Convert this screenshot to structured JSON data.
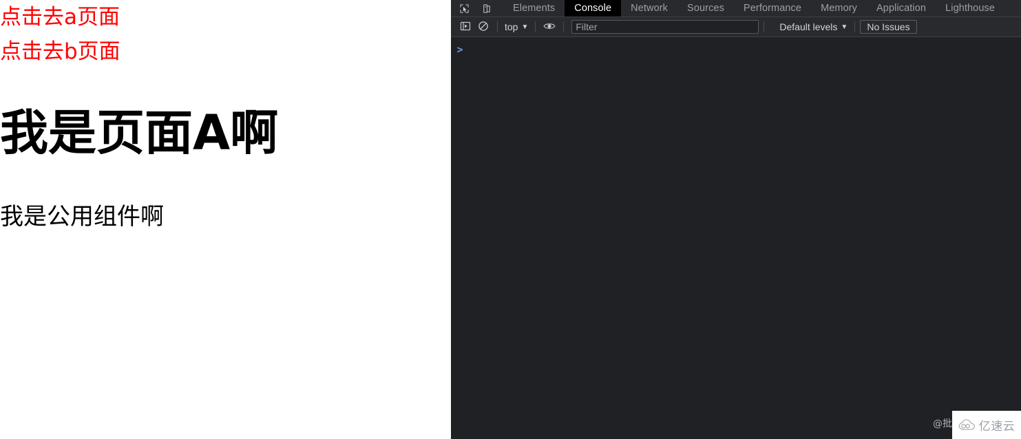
{
  "page": {
    "links": [
      {
        "label": "点击去a页面",
        "name": "link-goto-page-a"
      },
      {
        "label": "点击去b页面",
        "name": "link-goto-page-b"
      }
    ],
    "heading": "我是页面A啊",
    "subtext": "我是公用组件啊",
    "link_color": "#ff0000",
    "text_color": "#000000",
    "background": "#ffffff"
  },
  "devtools": {
    "background": "#202124",
    "toolbar_background": "#292a2d",
    "accent": "#6e9ad4",
    "tools": {
      "inspect_icon": "inspect-element-icon",
      "device_icon": "device-toolbar-icon"
    },
    "tabs": [
      {
        "label": "Elements",
        "active": false
      },
      {
        "label": "Console",
        "active": true
      },
      {
        "label": "Network",
        "active": false
      },
      {
        "label": "Sources",
        "active": false
      },
      {
        "label": "Performance",
        "active": false
      },
      {
        "label": "Memory",
        "active": false
      },
      {
        "label": "Application",
        "active": false
      },
      {
        "label": "Lighthouse",
        "active": false
      }
    ],
    "toolbar": {
      "sidebar_toggle_icon": "console-sidebar-icon",
      "clear_icon": "clear-console-icon",
      "context_label": "top",
      "eye_icon": "live-expression-icon",
      "filter_placeholder": "Filter",
      "filter_value": "",
      "levels_label": "Default levels",
      "issues_label": "No Issues"
    },
    "console": {
      "prompt": ">",
      "input_value": "",
      "messages": []
    }
  },
  "watermarks": {
    "dark_text": "@批",
    "brand_text": "亿速云",
    "brand_icon": "cloud-logo-icon"
  }
}
